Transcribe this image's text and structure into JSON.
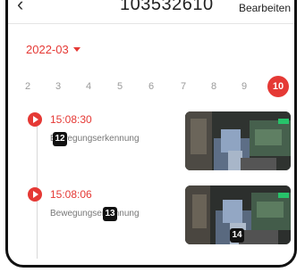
{
  "header": {
    "back_icon": "chevron-left-icon",
    "title": "103532610",
    "edit_label": "Bearbeiten"
  },
  "month_selector": {
    "label": "2022-03",
    "icon": "caret-down-icon"
  },
  "days": [
    "2",
    "3",
    "4",
    "5",
    "6",
    "7",
    "8",
    "9",
    "10"
  ],
  "selected_day": "10",
  "events": [
    {
      "time": "15:08:30",
      "label": "Bewegungserkennung",
      "badge": "12"
    },
    {
      "time": "15:08:06",
      "label": "Bewegungserkennung",
      "badge": "13",
      "thumb_badge": "14"
    }
  ],
  "colors": {
    "accent": "#e53935"
  }
}
